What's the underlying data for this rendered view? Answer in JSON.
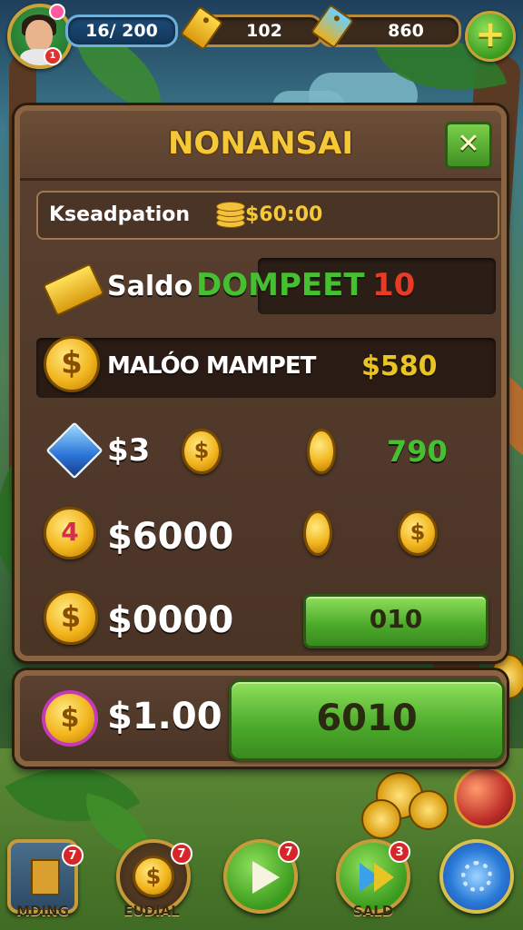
{
  "topbar": {
    "level_text": "16/ 200",
    "currency1": "102",
    "currency2": "860",
    "plus_label": "+",
    "avatar_badge": "1"
  },
  "panel": {
    "title": "NONANSAI",
    "close_label": "✕",
    "info": {
      "label": "Kseadpation",
      "value": "$60:00"
    },
    "row1": {
      "label": "Saldo",
      "highlight": "DOMPEET",
      "value": "10"
    },
    "row2": {
      "label": "MALÓO MAMPET",
      "value": "$580"
    },
    "row3": {
      "label": "$3",
      "value": "790",
      "coin_symbol": "$"
    },
    "row4": {
      "label": "$6000",
      "coin_symbol": "$",
      "coin_number": "4"
    },
    "row5": {
      "label": "$0000",
      "button": "010",
      "coin_symbol": "$"
    }
  },
  "bottom_panel": {
    "label": "$1.00",
    "button": "6010",
    "coin_symbol": "$"
  },
  "nav": [
    {
      "label": "MDING",
      "badge": "7",
      "icon": "house-icon"
    },
    {
      "label": "EUDIAL",
      "badge": "7",
      "icon": "coin-bag-icon"
    },
    {
      "label": "",
      "badge": "7",
      "icon": "play-icon"
    },
    {
      "label": "SALD",
      "badge": "3",
      "icon": "fast-forward-icon"
    },
    {
      "label": "",
      "badge": "",
      "icon": "settings-icon"
    }
  ],
  "colors": {
    "gold": "#f5c838",
    "green": "#44c030",
    "red": "#e83a24",
    "panel": "#4a3426"
  }
}
